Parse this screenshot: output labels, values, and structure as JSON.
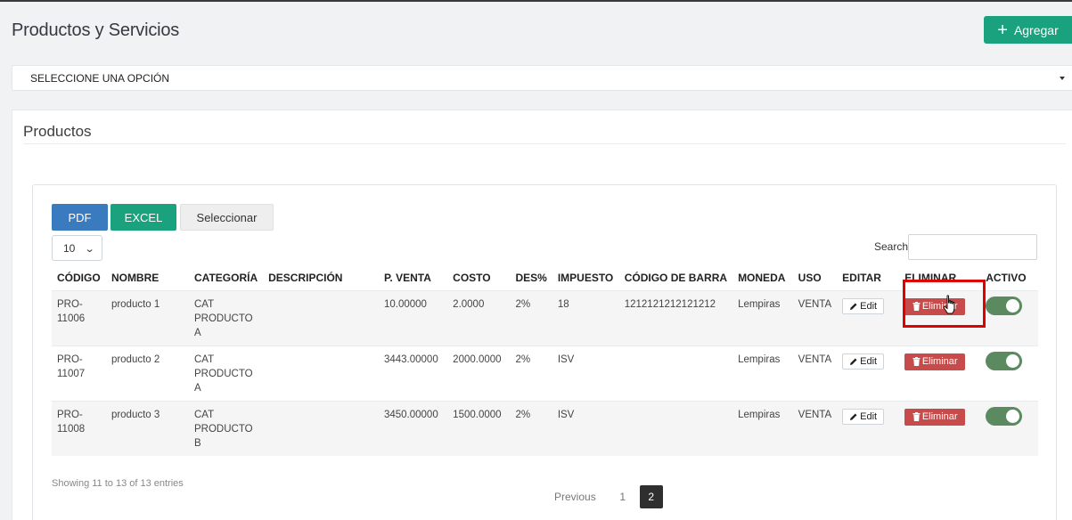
{
  "page": {
    "title": "Productos y Servicios"
  },
  "header": {
    "add_label": "Agregar"
  },
  "filter": {
    "value": "SELECCIONE UNA OPCIÓN"
  },
  "card": {
    "title": "Productos"
  },
  "toolbar": {
    "pdf_label": "PDF",
    "excel_label": "EXCEL",
    "select_label": "Seleccionar"
  },
  "length": {
    "value": "10"
  },
  "search": {
    "label": "Search:",
    "value": ""
  },
  "table": {
    "headers": [
      "CÓDIGO",
      "NOMBRE",
      "CATEGORÍA",
      "DESCRIPCIÓN",
      "P. VENTA",
      "COSTO",
      "DES%",
      "IMPUESTO",
      "CÓDIGO DE BARRA",
      "MONEDA",
      "USO",
      "EDITAR",
      "ELIMINAR",
      "ACTIVO"
    ],
    "rows": [
      {
        "codigo": "PRO-\n11006",
        "nombre": "producto 1",
        "categoria": "CAT\nPRODUCTO\nA",
        "descripcion": "",
        "p_venta": "10.00000",
        "costo": "2.0000",
        "des": "2%",
        "impuesto": "18",
        "codigo_barra": "1212121212121212",
        "moneda": "Lempiras",
        "uso": "VENTA",
        "edit": "Edit",
        "eliminar": "Eliminar",
        "activo": true
      },
      {
        "codigo": "PRO-\n11007",
        "nombre": "producto 2",
        "categoria": "CAT\nPRODUCTO\nA",
        "descripcion": "",
        "p_venta": "3443.00000",
        "costo": "2000.0000",
        "des": "2%",
        "impuesto": "ISV",
        "codigo_barra": "",
        "moneda": "Lempiras",
        "uso": "VENTA",
        "edit": "Edit",
        "eliminar": "Eliminar",
        "activo": true
      },
      {
        "codigo": "PRO-\n11008",
        "nombre": "producto 3",
        "categoria": "CAT\nPRODUCTO\nB",
        "descripcion": "",
        "p_venta": "3450.00000",
        "costo": "1500.0000",
        "des": "2%",
        "impuesto": "ISV",
        "codigo_barra": "",
        "moneda": "Lempiras",
        "uso": "VENTA",
        "edit": "Edit",
        "eliminar": "Eliminar",
        "activo": true
      }
    ]
  },
  "footer": {
    "info": "Showing 11 to 13 of 13 entries",
    "previous": "Previous",
    "pages": [
      "1",
      "2"
    ],
    "active_page": "2"
  },
  "colors": {
    "accent_green": "#1aa17e",
    "pdf_blue": "#3a7abf",
    "danger_red": "#c84b4b",
    "toggle_green": "#5b8a60",
    "highlight_red": "#e00000"
  }
}
